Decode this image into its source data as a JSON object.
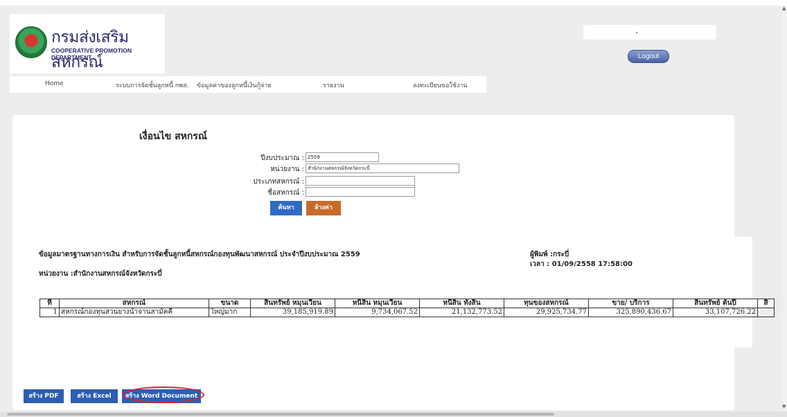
{
  "brand": {
    "th": "กรมส่งเสริมสหกรณ์",
    "en": "COOPERATIVE PROMOTION DEPARTMENT"
  },
  "header": {
    "user_text": "-",
    "logout_label": "Logout"
  },
  "nav": [
    {
      "label": "Home"
    },
    {
      "label": "ระบบการจัดชั้นลูกหนี้ กพส."
    },
    {
      "label": "ข้อมูลค่าของลูกหนี้เงินกู้จ่าย"
    },
    {
      "label": "รายงาน"
    },
    {
      "label": "ลงทะเบียนขอใช้งาน"
    }
  ],
  "form": {
    "title": "เงื่อนไข สหกรณ์",
    "fields": [
      {
        "label": "ปีงบประมาณ :",
        "value": "2559"
      },
      {
        "label": "หน่วยงาน :",
        "value": "สำนักงานสหกรณ์จังหวัดกระบี่"
      },
      {
        "label": "ประเภทสหกรณ์ :",
        "value": ""
      },
      {
        "label": "ชื่อสหกรณ์ :",
        "value": ""
      }
    ],
    "search_label": "ค้นหา",
    "clear_label": "ล้างค่า"
  },
  "report": {
    "title": "ข้อมูลมาตรฐานทางการเงิน สำหรับการจัดชั้นลูกหนี้สหกรณ์กองทุนพัฒนาสหกรณ์ ประจำปีงบประมาณ 2559",
    "unit": "หน่วยงาน :สำนักงานสหกรณ์จังหวัดกระบี่",
    "printer": "ผู้พิมพ์ :กระบี่",
    "time": "เวลา : 01/09/2558 17:58:00"
  },
  "table": {
    "headers": [
      "ที่",
      "สหกรณ์",
      "ขนาด",
      "สินทรัพย์ หมุนเวียน",
      "หนี้สิน หมุนเวียน",
      "หนี้สิน ทั้งสิ้น",
      "ทุนของสหกรณ์",
      "ขาย/ บริการ",
      "สินทรัพย์ ต้นปี",
      "สิ"
    ],
    "rows": [
      [
        "1",
        "สหกรณ์กองทุนสวนยางน้ำจานสามัคคี",
        "ใหญ่มาก",
        "39,185,919.89",
        "9,734,067.52",
        "21,132,773.52",
        "29,925,734.77",
        "325,890,436.67",
        "33,107,726.22",
        ""
      ]
    ]
  },
  "export": {
    "pdf_label": "สร้าง PDF",
    "excel_label": "สร้าง Excel",
    "word_label": "สร้าง Word Document"
  },
  "colors": {
    "search_button": "#2f6bc6",
    "clear_button": "#c86a28",
    "export_button": "#2c5eb4",
    "highlight": "#e01f2a"
  }
}
